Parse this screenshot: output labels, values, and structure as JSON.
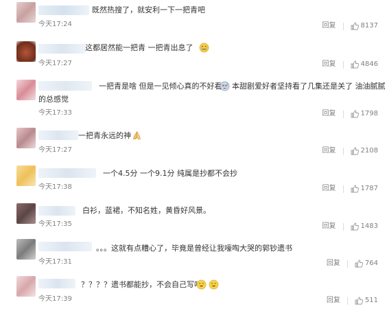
{
  "comments": [
    {
      "text": "既然热搜了，就安利一下一把青吧",
      "time": "今天17:24",
      "reply": "回复",
      "likes": "8137",
      "avatar_color": "#d8b5b5",
      "emoji": null
    },
    {
      "text": "这都居然能一把青 一把青出息了",
      "time": "今天17:27",
      "reply": "回复",
      "likes": "4846",
      "avatar_color": "#8a3a22",
      "emoji": "crying-face"
    },
    {
      "text_line1a": "一把青是啥 但是一见倾心真的不好看",
      "text_line1b": "本甜剧爱好者坚持看了几集还是关了 油油腻腻",
      "text_line2": "的总感觉",
      "time": "今天17:33",
      "reply": "回复",
      "likes": "1798",
      "avatar_color": "#e7b8c0",
      "emoji": "sweat-face"
    },
    {
      "text": "一把青永远的神",
      "time": "今天17:27",
      "reply": "回复",
      "likes": "2108",
      "avatar_color": "#d2a0a5",
      "emoji": "pray-hands"
    },
    {
      "text": "一个4.5分 一个9.1分 纯属是抄都不会抄",
      "time": "今天17:38",
      "reply": "回复",
      "likes": "1787",
      "avatar_color": "#f1d080",
      "emoji": null
    },
    {
      "text": "白衫，蓝裙，不知名姓，黄昏好风景。",
      "time": "今天17:35",
      "reply": "回复",
      "likes": "1483",
      "avatar_color": "#7a5f60",
      "emoji": null
    },
    {
      "text": "。。。这就有点糟心了，毕竟是曾经让我嚎啕大哭的郭钞遗书",
      "time": "今天17:31",
      "reply": "回复",
      "likes": "764",
      "avatar_color": "#9a9a9a",
      "emoji": null
    },
    {
      "text": "？？？？遗书都能抄，不会自己写吗",
      "time": "今天17:39",
      "reply": "回复",
      "likes": "511",
      "avatar_color": "#e8c6c8",
      "emoji": "smile-faces"
    }
  ],
  "colors": {
    "text": "#333333",
    "meta": "#808080",
    "name_blur": "#dfe8f2"
  }
}
